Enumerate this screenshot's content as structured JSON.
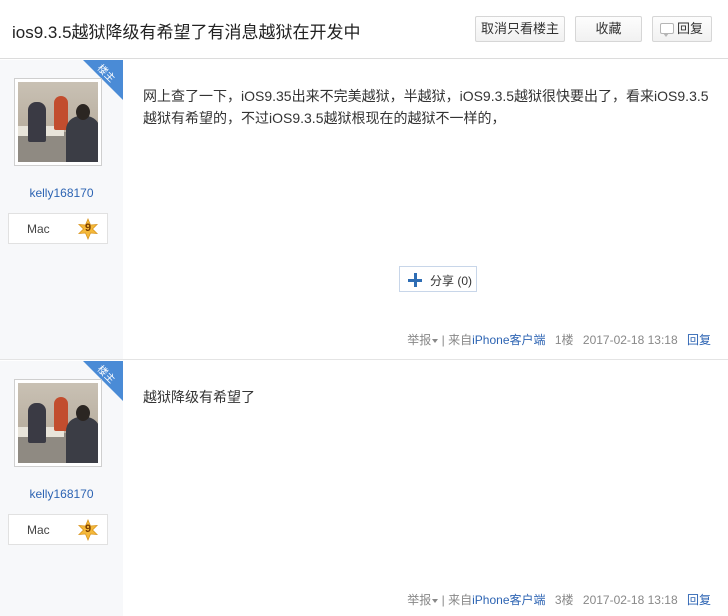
{
  "header": {
    "title": "ios9.3.5越狱降级有希望了有消息越狱在开发中",
    "cancel_only_op_label": "取消只看楼主",
    "favorite_label": "收藏",
    "reply_label": "回复"
  },
  "posts": [
    {
      "badge": "楼主",
      "username": "kelly168170",
      "level_name": "Mac",
      "level": "9",
      "content": "网上查了一下，iOS9.35出来不完美越狱，半越狱，iOS9.3.5越狱很快要出了，看来iOS9.3.5越狱有希望的，不过iOS9.3.5越狱根现在的越狱不一样的，",
      "share_label": "分享 (0)",
      "report_label": "举报",
      "separator": "|",
      "source_prefix": "来自",
      "source_link": "iPhone客户端",
      "floor": "1楼",
      "timestamp": "2017-02-18 13:18",
      "reply_label": "回复"
    },
    {
      "badge": "楼主",
      "username": "kelly168170",
      "level_name": "Mac",
      "level": "9",
      "content": "越狱降级有希望了",
      "report_label": "举报",
      "separator": "|",
      "source_prefix": "来自",
      "source_link": "iPhone客户端",
      "floor": "3楼",
      "timestamp": "2017-02-18 13:18",
      "reply_label": "回复"
    }
  ],
  "colors": {
    "accent": "#2d64b3",
    "badge": "#4a8bd6",
    "sidebar_bg": "#f7f8fa",
    "level_badge": "#f5b93a"
  }
}
